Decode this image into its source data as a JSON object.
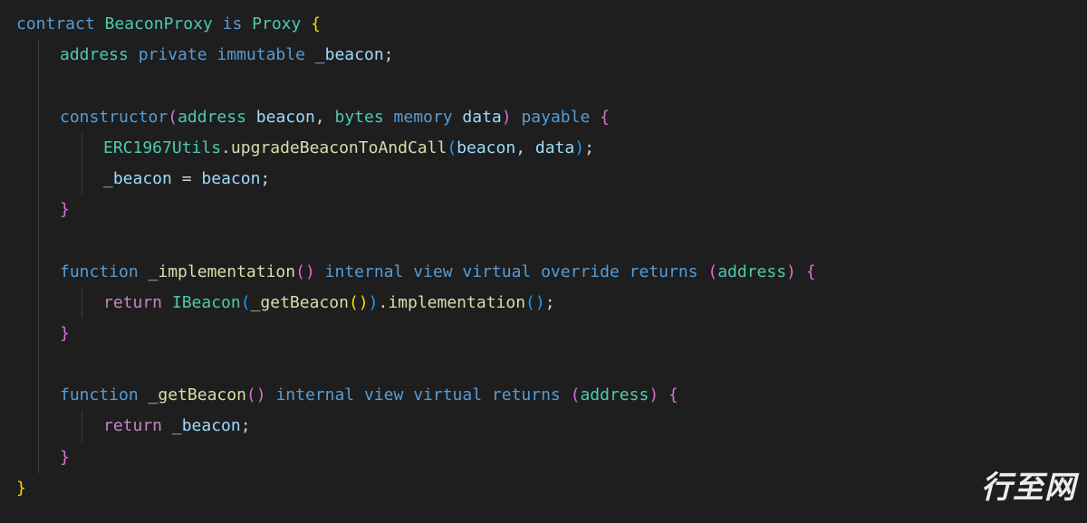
{
  "code": {
    "l1": {
      "kw_contract": "contract",
      "name": "BeaconProxy",
      "kw_is": "is",
      "parent": "Proxy",
      "brace": "{"
    },
    "l2": {
      "type": "address",
      "kw_private": "private",
      "kw_immutable": "immutable",
      "var": "_beacon",
      "semi": ";"
    },
    "l3": {
      "ctor": "constructor",
      "p_type1": "address",
      "p_name1": "beacon",
      "comma": ",",
      "p_type2": "bytes",
      "kw_memory": "memory",
      "p_name2": "data",
      "kw_payable": "payable",
      "brace": "{"
    },
    "l4": {
      "cls": "ERC1967Utils",
      "dot": ".",
      "fn": "upgradeBeaconToAndCall",
      "arg1": "beacon",
      "comma": ",",
      "arg2": "data",
      "semi": ";"
    },
    "l5": {
      "lhs": "_beacon",
      "eq": "=",
      "rhs": "beacon",
      "semi": ";"
    },
    "l6": {
      "brace": "}"
    },
    "l7": {
      "kw_function": "function",
      "name": "_implementation",
      "kw_internal": "internal",
      "kw_view": "view",
      "kw_virtual": "virtual",
      "kw_override": "override",
      "kw_returns": "returns",
      "ret_type": "address",
      "brace": "{"
    },
    "l8": {
      "kw_return": "return",
      "cls": "IBeacon",
      "fn1": "_getBeacon",
      "dot": ".",
      "fn2": "implementation",
      "semi": ";"
    },
    "l9": {
      "brace": "}"
    },
    "l10": {
      "kw_function": "function",
      "name": "_getBeacon",
      "kw_internal": "internal",
      "kw_view": "view",
      "kw_virtual": "virtual",
      "kw_returns": "returns",
      "ret_type": "address",
      "brace": "{"
    },
    "l11": {
      "kw_return": "return",
      "var": "_beacon",
      "semi": ";"
    },
    "l12": {
      "brace": "}"
    },
    "l13": {
      "brace": "}"
    }
  },
  "watermark": "行至网"
}
